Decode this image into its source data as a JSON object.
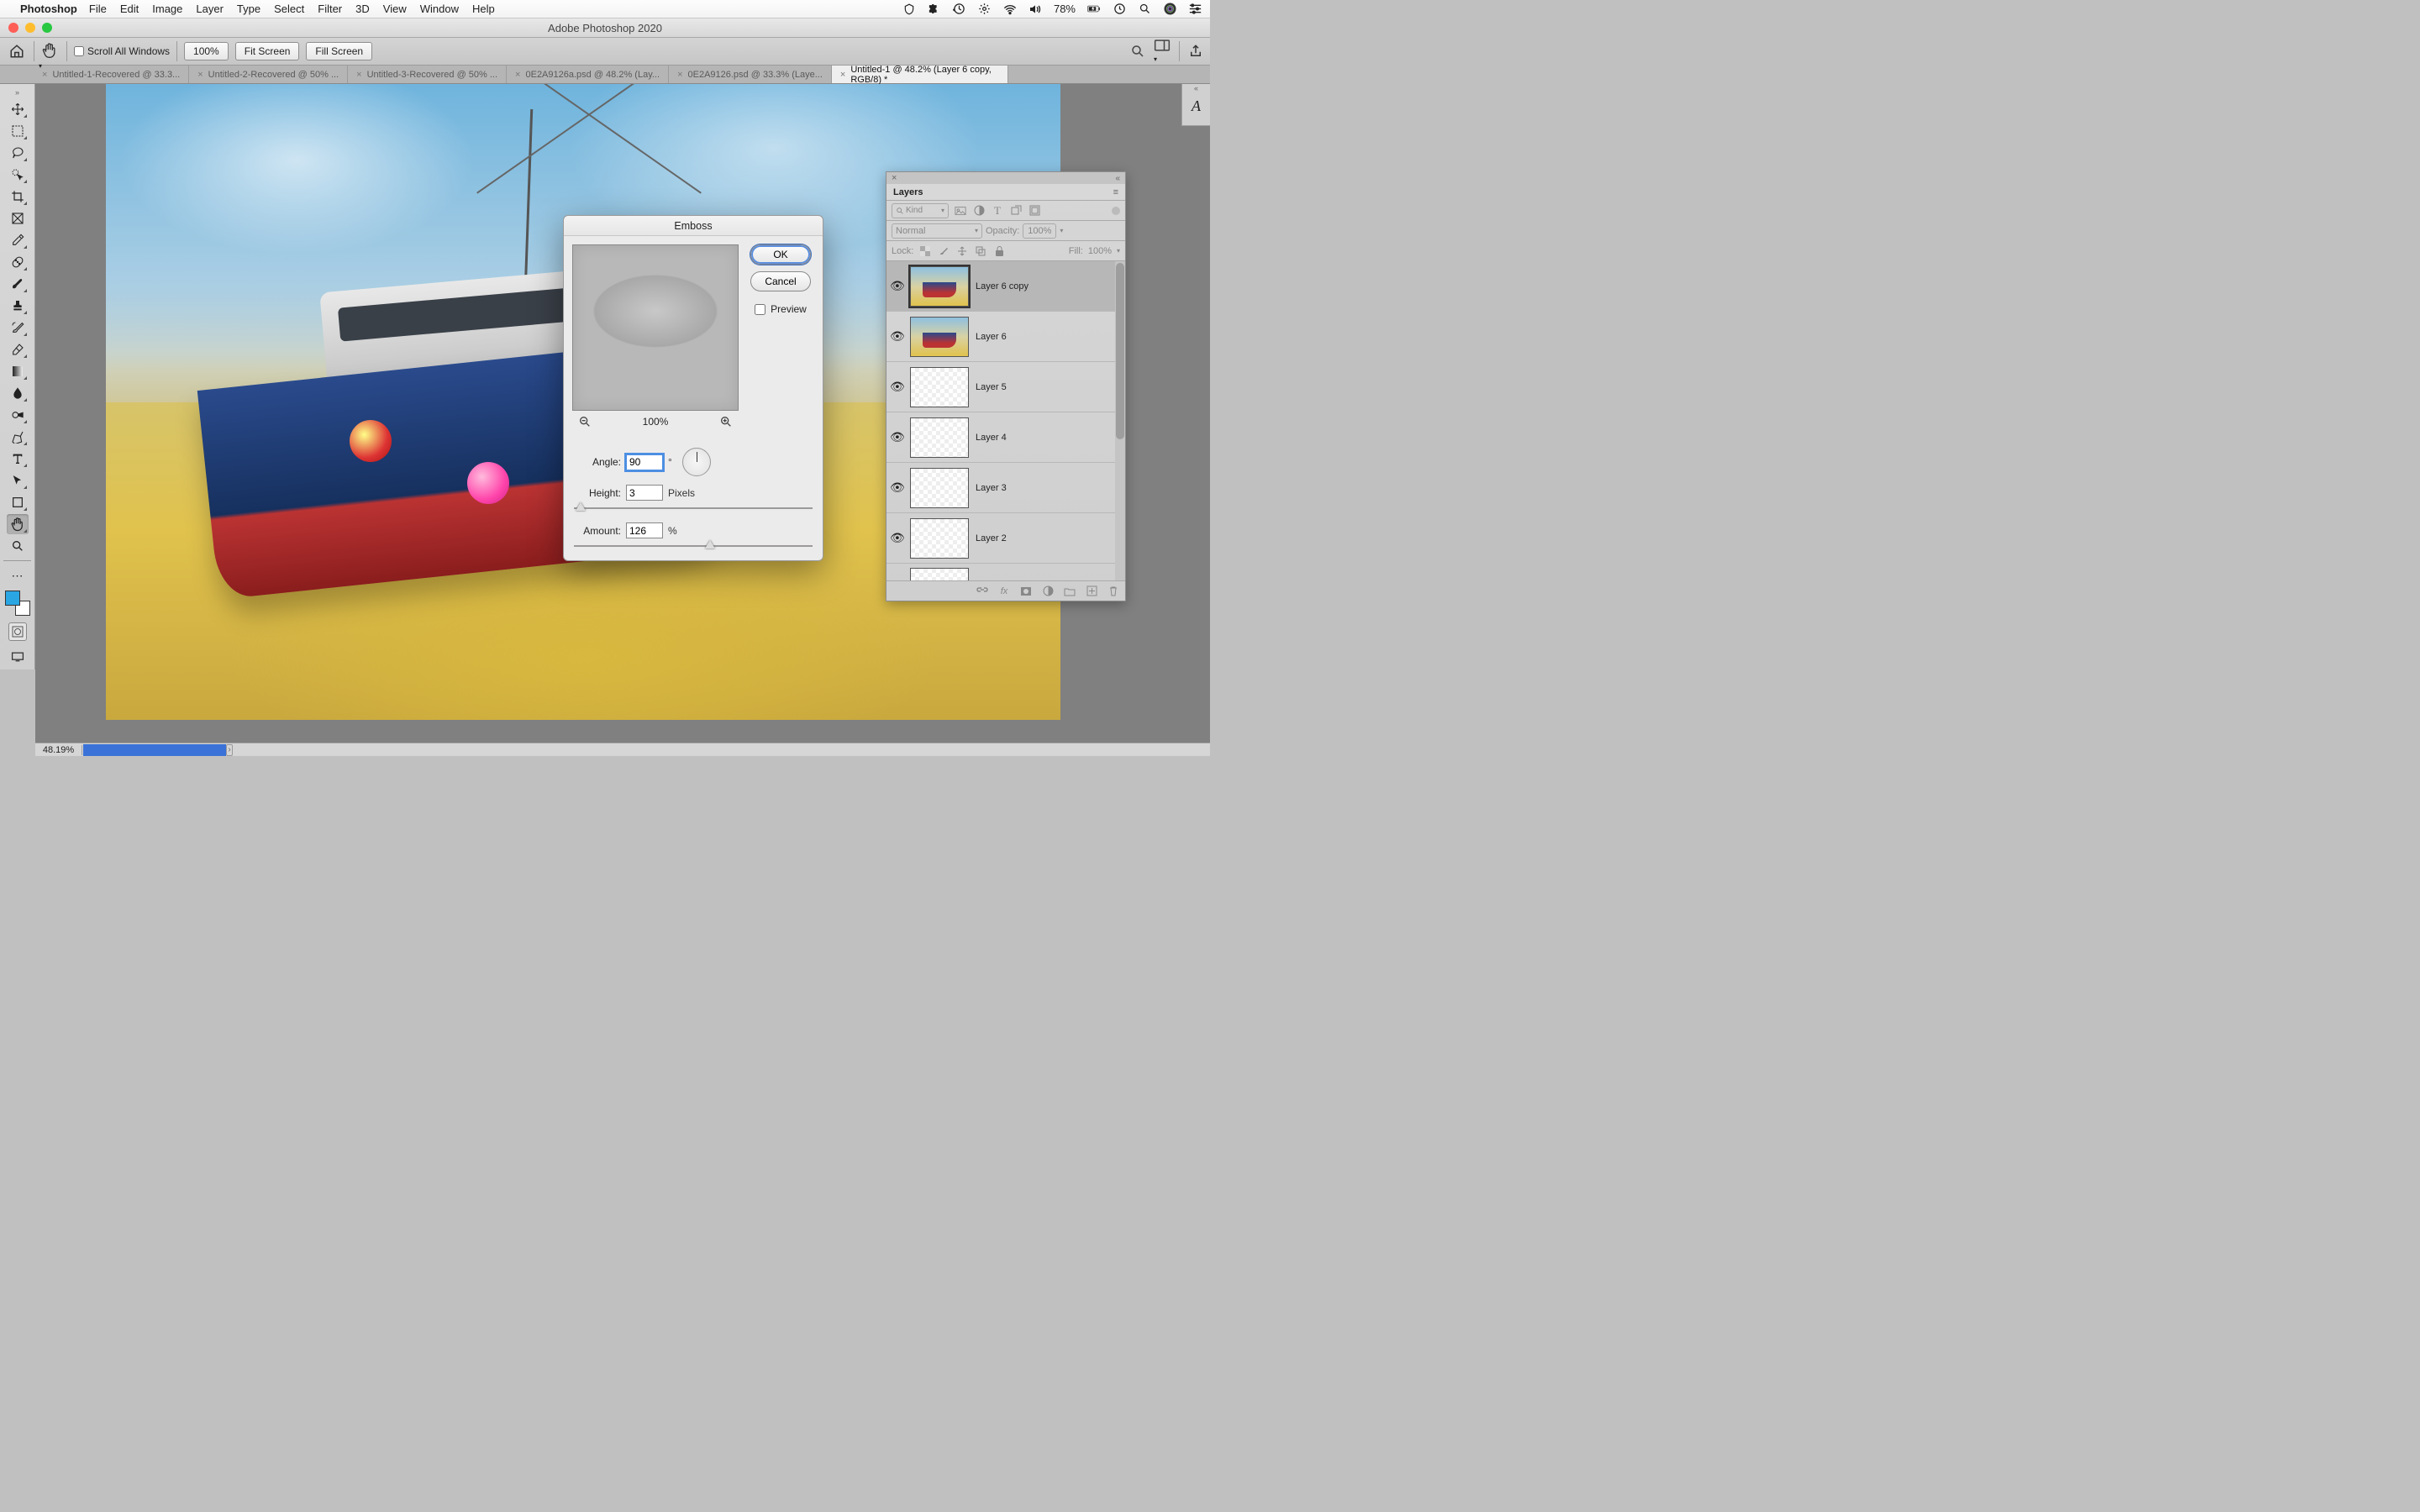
{
  "menubar": {
    "app": "Photoshop",
    "items": [
      "File",
      "Edit",
      "Image",
      "Layer",
      "Type",
      "Select",
      "Filter",
      "3D",
      "View",
      "Window",
      "Help"
    ],
    "battery": "78%"
  },
  "window_title": "Adobe Photoshop 2020",
  "optbar": {
    "scroll_all": "Scroll All Windows",
    "zoom": "100%",
    "fit": "Fit Screen",
    "fill": "Fill Screen"
  },
  "tabs": [
    {
      "label": "Untitled-1-Recovered @ 33.3..."
    },
    {
      "label": "Untitled-2-Recovered @ 50% ..."
    },
    {
      "label": "Untitled-3-Recovered @ 50% ..."
    },
    {
      "label": "0E2A9126a.psd @ 48.2% (Lay..."
    },
    {
      "label": "0E2A9126.psd @ 33.3% (Laye..."
    },
    {
      "label": "Untitled-1 @ 48.2% (Layer 6 copy, RGB/8) *",
      "active": true
    }
  ],
  "status": {
    "zoom": "48.19%"
  },
  "dialog": {
    "title": "Emboss",
    "ok": "OK",
    "cancel": "Cancel",
    "preview": "Preview",
    "zoom": "100%",
    "angle_label": "Angle:",
    "angle": "90",
    "angle_unit": "°",
    "height_label": "Height:",
    "height": "3",
    "height_unit": "Pixels",
    "amount_label": "Amount:",
    "amount": "126",
    "amount_unit": "%"
  },
  "layers": {
    "title": "Layers",
    "kind": "Kind",
    "blend": "Normal",
    "opacity_label": "Opacity:",
    "opacity": "100%",
    "lock_label": "Lock:",
    "fill_label": "Fill:",
    "fill": "100%",
    "items": [
      {
        "name": "Layer 6 copy",
        "sel": true,
        "thumb": "img"
      },
      {
        "name": "Layer 6",
        "thumb": "img"
      },
      {
        "name": "Layer 5",
        "thumb": "trans"
      },
      {
        "name": "Layer 4",
        "thumb": "trans"
      },
      {
        "name": "Layer 3",
        "thumb": "trans"
      },
      {
        "name": "Layer 2",
        "thumb": "trans"
      }
    ]
  },
  "colors": {
    "fg": "#2aa6e3",
    "bg": "#ffffff",
    "accent": "#3a72d8"
  }
}
